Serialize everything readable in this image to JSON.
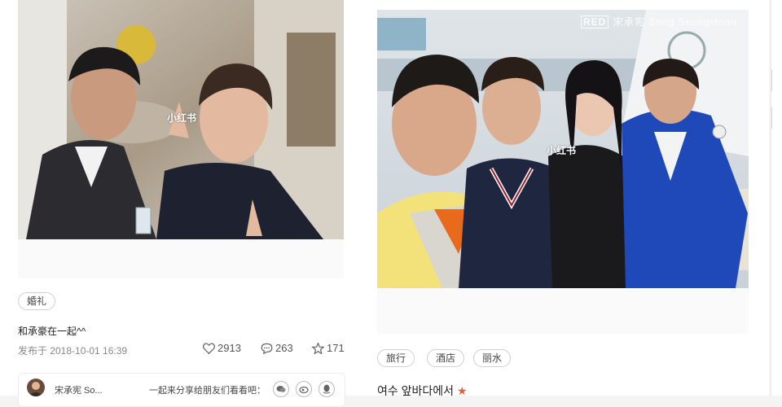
{
  "left_post": {
    "tags": [
      "婚礼"
    ],
    "caption": "和承豪在一起^^",
    "published": "发布于 2018-10-01 16:39",
    "likes": "2913",
    "comments": "263",
    "favorites": "171",
    "watermark": "小红书",
    "share": {
      "author": "宋承宪 So...",
      "prompt": "一起来分享给朋友们看看吧："
    }
  },
  "right_post": {
    "tags": [
      "旅行",
      "酒店",
      "丽水"
    ],
    "caption": "여수 앞바다에서",
    "watermark": "小红书",
    "red_mark": "RED",
    "red_credit": "宋承宪 Song SeungHeon"
  },
  "icons": [
    "heart-icon",
    "comment-icon",
    "star-icon",
    "wechat-icon",
    "weibo-icon",
    "qq-icon"
  ]
}
